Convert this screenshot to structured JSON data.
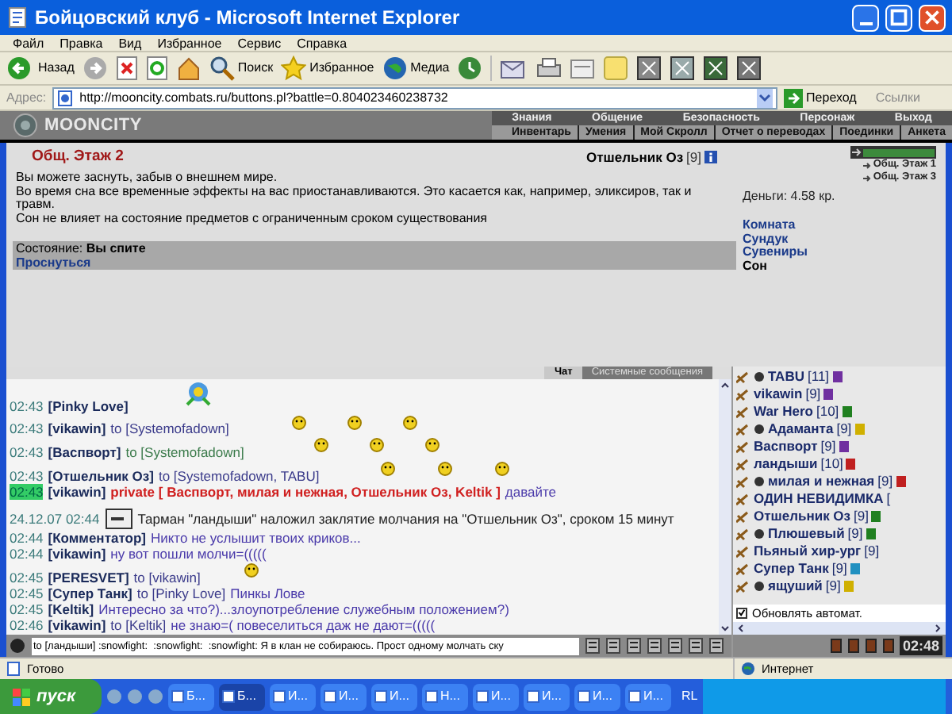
{
  "window": {
    "title": "Бойцовский клуб - Microsoft Internet Explorer"
  },
  "menu": [
    "Файл",
    "Правка",
    "Вид",
    "Избранное",
    "Сервис",
    "Справка"
  ],
  "toolbar": {
    "back": "Назад",
    "search": "Поиск",
    "favorites": "Избранное",
    "media": "Медиа"
  },
  "address": {
    "label": "Адрес:",
    "url": "http://mooncity.combats.ru/buttons.pl?battle=0.804023460238732",
    "go": "Переход",
    "links": "Ссылки"
  },
  "site": {
    "logo": "MOONCITY",
    "nav_top": [
      "Знания",
      "Общение",
      "Безопасность",
      "Персонаж",
      "Выход"
    ],
    "nav_bottom": [
      "Инвентарь",
      "Умения",
      "Мой Скролл",
      "Отчет о переводах",
      "Поединки",
      "Анкета"
    ]
  },
  "room": {
    "title": "Общ. Этаж 2",
    "character": "Отшельник Оз",
    "character_level": "[9]",
    "paragraphs": [
      "Вы можете заснуть, забыв о внешнем мире.",
      "Во время сна все временные эффекты на вас приостанавливаются. Это касается как, например, эликсиров, так и травм.",
      "Сон не влияет на состояние предметов с ограниченным сроком существования"
    ],
    "state": "Состояние: **Вы спите**",
    "wake_link": "Проснуться",
    "health": {
      "level": 1.0
    },
    "exits": [
      "Общ. Этаж 1",
      "Общ. Этаж 3"
    ],
    "money": "Деньги: 4.58 кр.",
    "places": [
      {
        "label": "Комната",
        "selected": false
      },
      {
        "label": "Сундук",
        "selected": false
      },
      {
        "label": "Сувениры",
        "selected": false
      },
      {
        "label": "Сон",
        "selected": true
      }
    ]
  },
  "chat_tabs": [
    {
      "label": "Чат",
      "selected": true
    },
    {
      "label": "Системные сообщения",
      "selected": false
    }
  ],
  "messages": [
    {
      "kind": "chat",
      "time": "02:43",
      "author": "[Pinky Love]",
      "highlight": false
    },
    {
      "kind": "chat",
      "time": "02:43",
      "author": "[vikawin]",
      "to": "to [Systemofadown]",
      "highlight": false
    },
    {
      "kind": "chat",
      "time": "02:43",
      "author": "[Васпворт]",
      "to": "to [Systemofadown]",
      "highlight": false
    },
    {
      "kind": "chat",
      "time": "02:43",
      "author": "[Отшельник Оз]",
      "to": "to [Systemofadown, TABU]",
      "highlight": false
    },
    {
      "kind": "private",
      "time": "02:43",
      "author": "[vikawin]",
      "to": "private [ Васпворт, милая и нежная, Отшельник Оз, Keltik ]",
      "text": "давайте",
      "highlight": true
    },
    {
      "kind": "system",
      "time": "24.12.07 02:44",
      "text": "Тарман \"ландыши\" наложил заклятие молчания на \"Отшельник Оз\", сроком 15 минут"
    },
    {
      "kind": "chat",
      "time": "02:44",
      "author": "[Комментатор]",
      "text": "Никто не услышит твоих криков...",
      "highlight": false
    },
    {
      "kind": "chat",
      "time": "02:44",
      "author": "[vikawin]",
      "text": "ну вот пошли молчи=(((((",
      "highlight": false
    },
    {
      "kind": "chat",
      "time": "02:45",
      "author": "[PERESVET]",
      "to": "to [vikawin]",
      "highlight": false
    },
    {
      "kind": "chat",
      "time": "02:45",
      "author": "[Супер Танк]",
      "to": "to [Pinky Love]",
      "text": "Пинкы Лове",
      "highlight": false
    },
    {
      "kind": "chat",
      "time": "02:45",
      "author": "[Keltik]",
      "text": "Интересно за что?)...злоупотребление служебным положением?)",
      "highlight": false
    },
    {
      "kind": "chat",
      "time": "02:46",
      "author": "[vikawin]",
      "to": "to [Keltik]",
      "text": "не знаю=( повеселиться даж не дают=(((((",
      "highlight": false
    }
  ],
  "users": [
    {
      "name": "TABU",
      "level": "[11]",
      "color": "#7030a0"
    },
    {
      "name": "vikawin",
      "level": "[9]",
      "color": "#7030a0"
    },
    {
      "name": "War Hero",
      "level": "[10]",
      "color": "#208020"
    },
    {
      "name": "Адаманта",
      "level": "[9]",
      "color": "#d0b000"
    },
    {
      "name": "Васпворт",
      "level": "[9]",
      "color": "#7030a0"
    },
    {
      "name": "ландыши",
      "level": "[10]",
      "color": "#c02020"
    },
    {
      "name": "милая и нежная",
      "level": "[9]",
      "color": "#c02020"
    },
    {
      "name": "ОДИН НЕВИДИМКА",
      "level": "["
    },
    {
      "name": "Отшельник Оз",
      "level": "[9]",
      "color": "#208020"
    },
    {
      "name": "Плюшевый",
      "level": "[9]",
      "color": "#208020"
    },
    {
      "name": "Пьяный хир-ург",
      "level": "[9]"
    },
    {
      "name": "Супер Танк",
      "level": "[9]",
      "color": "#2090c0"
    },
    {
      "name": "ящуший",
      "level": "[9]",
      "color": "#d0b000"
    }
  ],
  "auto_refresh": {
    "label": "Обновлять автомат.",
    "checked": true
  },
  "chat_input": {
    "value": "to [ландыши] :snowfight:  :snowfight:  :snowfight: Я в клан не собираюсь. Прост одному молчать ску"
  },
  "clock": "02:48",
  "status_bar": {
    "text": "Готово",
    "zone": "Интернет"
  },
  "taskbar": {
    "start": "пуск",
    "buttons": [
      {
        "label": "Б...",
        "selected": false
      },
      {
        "label": "Б...",
        "selected": true
      },
      {
        "label": "И...",
        "selected": false
      },
      {
        "label": "И...",
        "selected": false
      },
      {
        "label": "И...",
        "selected": false
      },
      {
        "label": "Н...",
        "selected": false
      },
      {
        "label": "И...",
        "selected": false
      },
      {
        "label": "И...",
        "selected": false
      },
      {
        "label": "И...",
        "selected": false
      },
      {
        "label": "И...",
        "selected": false
      }
    ],
    "tray": "RL"
  }
}
